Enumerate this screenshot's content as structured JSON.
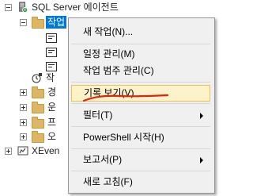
{
  "tree": {
    "agent_label": "SQL Server 에이전트",
    "selected_node_label": "작업",
    "partial_label_1": "작",
    "partial_label_2": "경",
    "partial_label_3": "운",
    "partial_label_4": "프",
    "partial_label_5": "오",
    "xevent_label": "XEven"
  },
  "menu": {
    "items": {
      "new_job": "새 작업(N)...",
      "manage_schedules": "일정 관리(M)",
      "manage_categories": "작업 범주 관리(C)",
      "view_history": "기록 보기(V)",
      "filter": "필터(T)",
      "powershell": "PowerShell 시작(H)",
      "reports": "보고서(P)",
      "refresh": "새로 고침(F)"
    }
  },
  "colors": {
    "selection": "#0078d7",
    "menu_background": "#f0f0f0",
    "menu_highlight": "#fcf3c9",
    "annotation_underline": "#e0201a"
  },
  "icons": {
    "agent": "sql-agent-icon",
    "folder": "folder-icon",
    "job": "job-icon",
    "submenu": "submenu-arrow-icon"
  }
}
